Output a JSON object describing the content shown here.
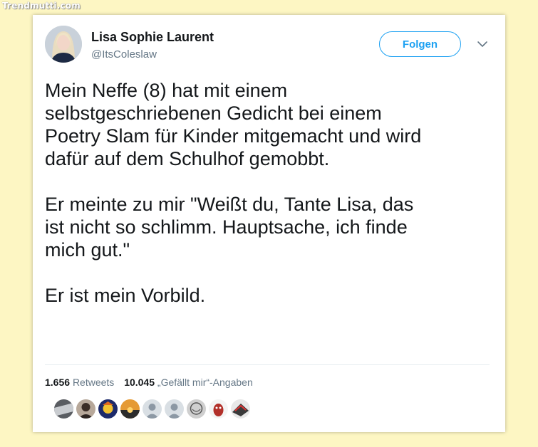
{
  "watermark": "Trendmutti.com",
  "tweet": {
    "author_name": "Lisa Sophie Laurent",
    "author_handle": "@ItsColeslaw",
    "follow_label": "Folgen",
    "paragraphs": [
      "Mein Neffe (8) hat mit einem\nselbstgeschriebenen Gedicht bei einem\nPoetry Slam für Kinder mitgemacht und wird\ndafür auf dem Schulhof gemobbt.",
      "Er meinte zu mir \"Weißt du, Tante Lisa, das\nist nicht so schlimm. Hauptsache, ich finde\nmich gut.\"",
      "Er ist mein Vorbild."
    ],
    "retweets_count": "1.656",
    "retweets_label": "Retweets",
    "likes_count": "10.045",
    "likes_label": "„Gefällt mir“-Angaben"
  },
  "icons": {
    "avatar": "profile-photo",
    "menu": "chevron-down-icon"
  },
  "colors": {
    "background": "#fdf6c3",
    "accent": "#1da1f2",
    "text": "#14171a",
    "muted": "#657786"
  }
}
